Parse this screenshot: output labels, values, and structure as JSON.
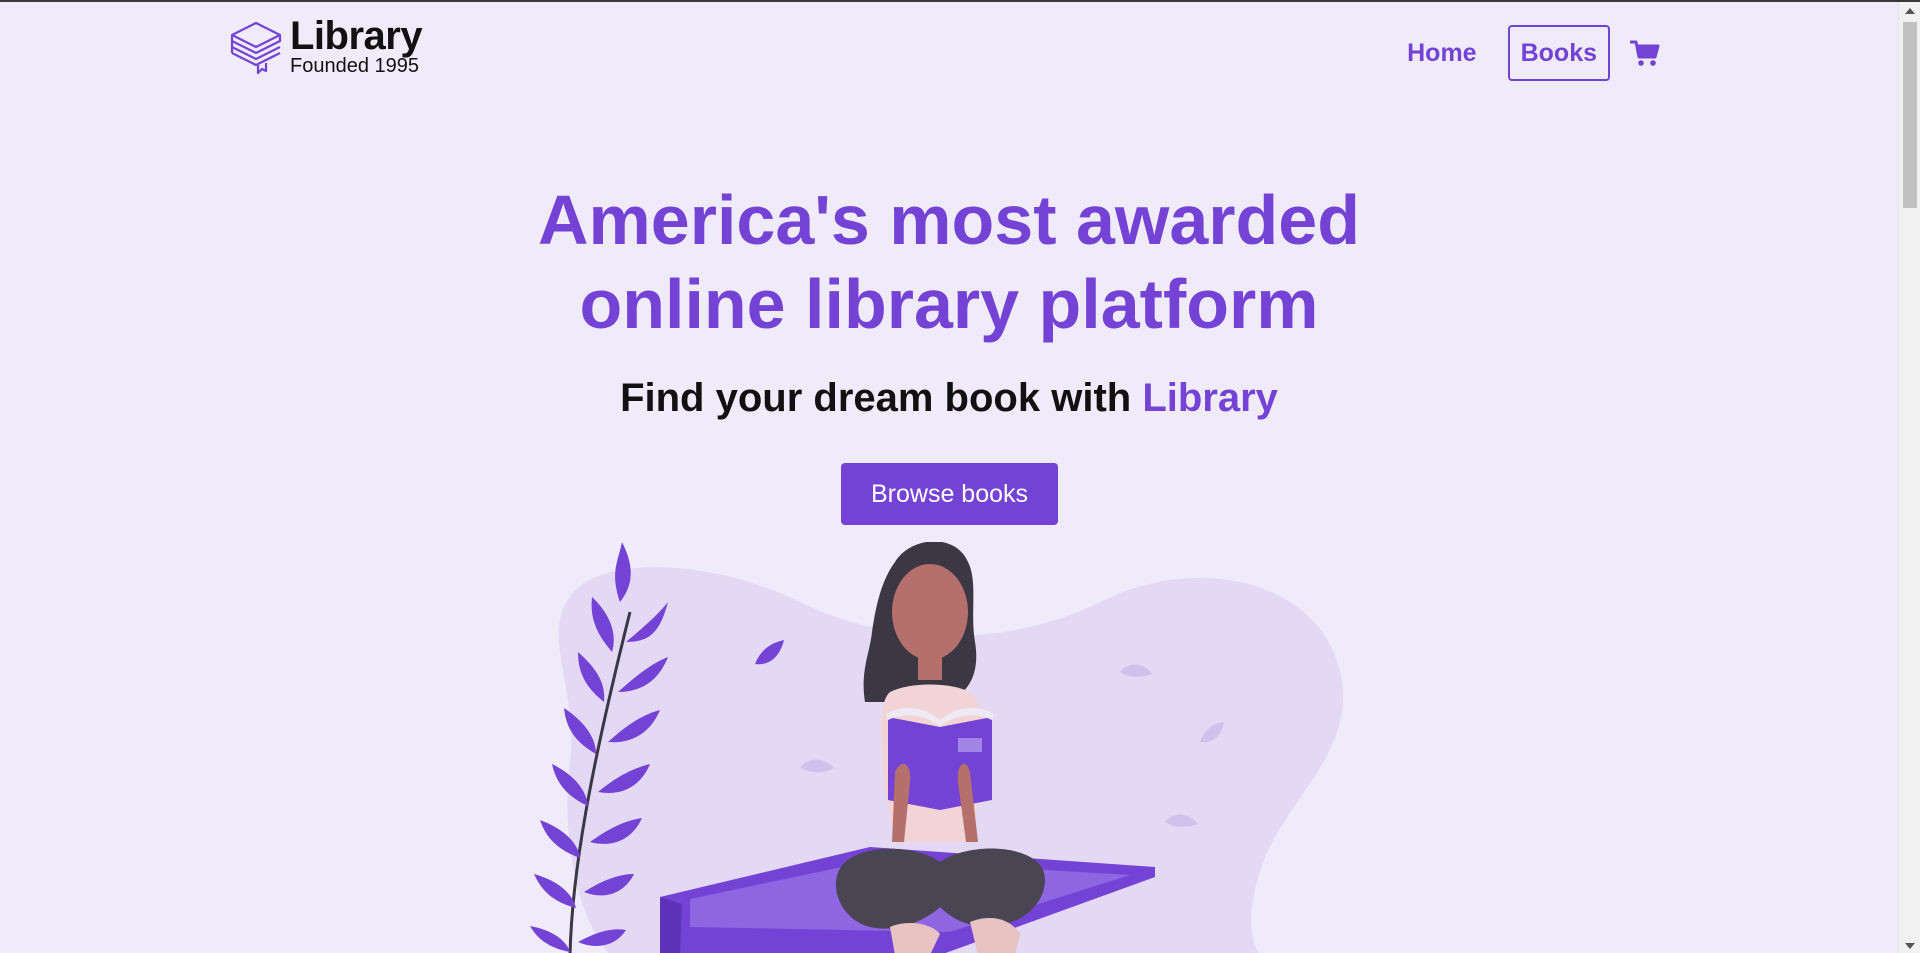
{
  "brand": {
    "title": "Library",
    "subtitle": "Founded 1995"
  },
  "nav": {
    "links": [
      {
        "label": "Home",
        "active": false
      },
      {
        "label": "Books",
        "active": true
      }
    ],
    "cart_icon": "shopping-cart-icon"
  },
  "hero": {
    "title_line1": "America's most awarded",
    "title_line2": "online library platform",
    "subtitle_prefix": "Find your dream book with ",
    "subtitle_accent": "Library",
    "cta_label": "Browse books"
  },
  "colors": {
    "accent": "#7443d6",
    "background": "#f0ebfa",
    "blob": "#e3d9f5",
    "text": "#111111"
  }
}
